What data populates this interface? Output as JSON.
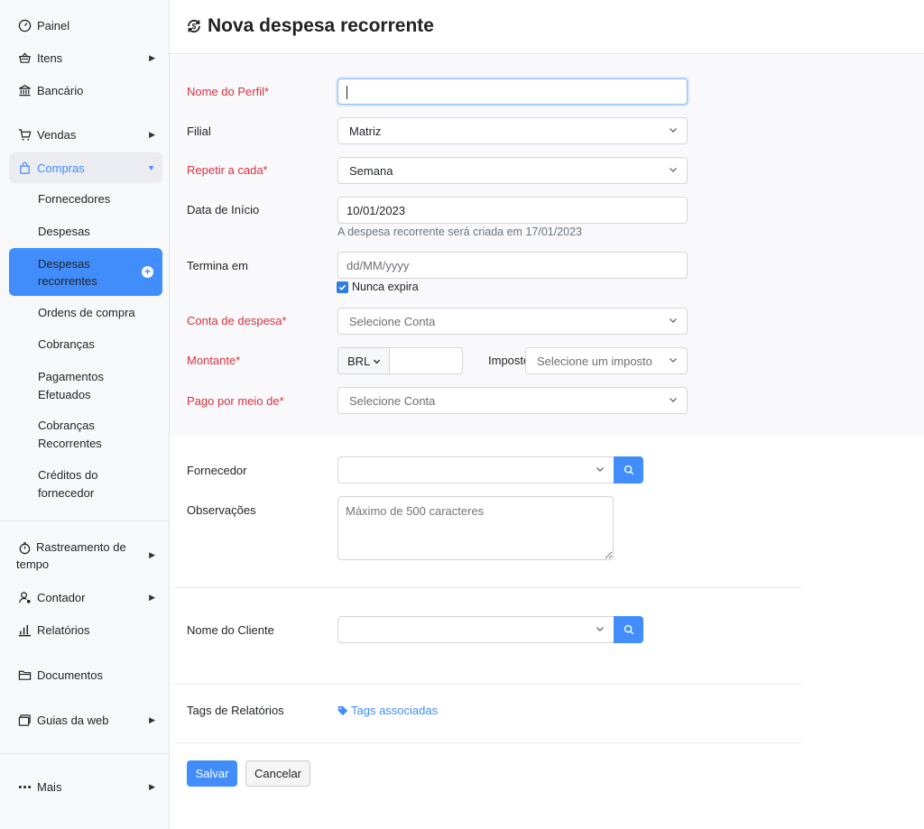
{
  "sidebar": {
    "items": [
      {
        "label": "Painel",
        "icon": "dashboard-icon"
      },
      {
        "label": "Itens",
        "icon": "basket-icon"
      },
      {
        "label": "Bancário",
        "icon": "bank-icon"
      },
      {
        "label": "Vendas",
        "icon": "cart-icon"
      },
      {
        "label": "Compras",
        "icon": "bag-icon"
      },
      {
        "label": "Rastreamento de tempo",
        "icon": "stopwatch-icon"
      },
      {
        "label": "Contador",
        "icon": "accountant-icon"
      },
      {
        "label": "Relatórios",
        "icon": "reports-icon"
      },
      {
        "label": "Documentos",
        "icon": "folder-icon"
      },
      {
        "label": "Guias da web",
        "icon": "web-tabs-icon"
      },
      {
        "label": "Mais",
        "icon": "more-icon"
      }
    ],
    "compras_sub": [
      {
        "label": "Fornecedores"
      },
      {
        "label": "Despesas"
      },
      {
        "label": "Despesas recorrentes",
        "active": true
      },
      {
        "label": "Ordens de compra"
      },
      {
        "label": "Cobranças"
      },
      {
        "label": "Pagamentos Efetuados"
      },
      {
        "label": "Cobranças Recorrentes"
      },
      {
        "label": "Créditos do fornecedor"
      }
    ]
  },
  "header": {
    "title": "Nova despesa recorrente"
  },
  "form": {
    "profile_name": {
      "label": "Nome do Perfil*",
      "value": ""
    },
    "branch": {
      "label": "Filial",
      "value": "Matriz"
    },
    "repeat": {
      "label": "Repetir a cada*",
      "value": "Semana"
    },
    "start_date": {
      "label": "Data de Início",
      "value": "10/01/2023",
      "hint": "A despesa recorrente será criada em 17/01/2023"
    },
    "ends_on": {
      "label": "Termina em",
      "placeholder": "dd/MM/yyyy",
      "never_expires_label": "Nunca expira",
      "never_expires": true
    },
    "expense_account": {
      "label": "Conta de despesa*",
      "placeholder": "Selecione Conta"
    },
    "amount": {
      "label": "Montante*",
      "currency": "BRL",
      "value": ""
    },
    "tax": {
      "label": "Imposto",
      "placeholder": "Selecione um imposto"
    },
    "paid_through": {
      "label": "Pago por meio de*",
      "placeholder": "Selecione Conta"
    },
    "vendor": {
      "label": "Fornecedor",
      "value": ""
    },
    "notes": {
      "label": "Observações",
      "placeholder": "Máximo de 500 caracteres"
    },
    "customer": {
      "label": "Nome do Cliente",
      "value": ""
    },
    "report_tags": {
      "label": "Tags de Relatórios",
      "link": "Tags associadas"
    }
  },
  "actions": {
    "save": "Salvar",
    "cancel": "Cancelar"
  },
  "colors": {
    "accent": "#408dfb",
    "required": "#d6333f",
    "sidebar_bg": "#f7f8fa"
  }
}
